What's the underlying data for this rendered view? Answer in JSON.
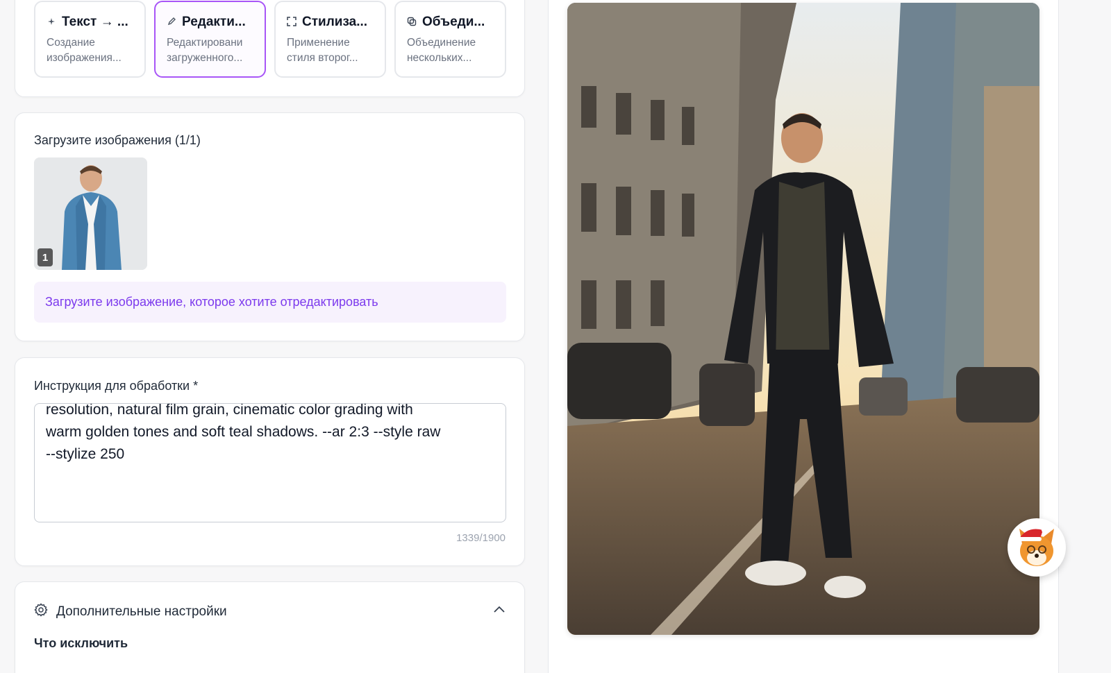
{
  "modes": [
    {
      "title": "Текст → ...",
      "desc_line1": "Создание",
      "desc_line2": "изображения...",
      "icon": "sparkle-icon"
    },
    {
      "title": "Редакти...",
      "desc_line1": "Редактировани",
      "desc_line2": "загруженного...",
      "icon": "pen-icon",
      "active": true
    },
    {
      "title": "Стилиза...",
      "desc_line1": "Применение",
      "desc_line2": "стиля второг...",
      "icon": "expand-icon"
    },
    {
      "title": "Объеди...",
      "desc_line1": "Объединение",
      "desc_line2": "нескольких...",
      "icon": "copy-icon"
    }
  ],
  "upload": {
    "label": "Загрузите изображения (1/1)",
    "thumb_number": "1",
    "hint": "Загрузите изображение, которое хотите отредактировать"
  },
  "instruction": {
    "label": "Инструкция для обработки *",
    "line1": "resolution, natural film grain, cinematic color grading with",
    "line2": "warm golden tones and soft teal shadows. --ar 2:3 --style raw",
    "line3": "--stylize 250",
    "counter": "1339/1900"
  },
  "advanced": {
    "title": "Дополнительные настройки",
    "exclude_label": "Что исключить"
  },
  "colors": {
    "accent": "#a855f7",
    "hint_text": "#7c3aed",
    "hint_bg": "#f7f2fd"
  }
}
